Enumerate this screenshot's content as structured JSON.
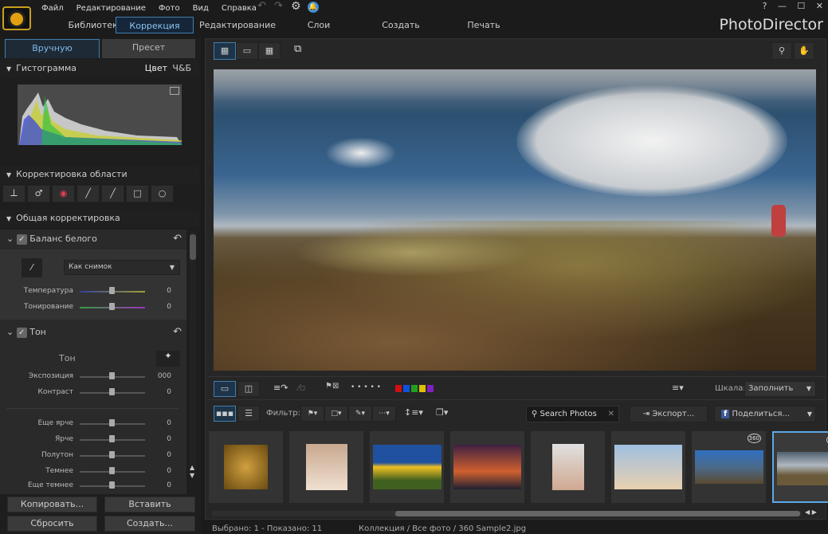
{
  "app": {
    "title": "PhotoDirector"
  },
  "menu": [
    "Файл",
    "Редактирование",
    "Фото",
    "Вид",
    "Справка"
  ],
  "modes": [
    "Библиотека",
    "Коррекция",
    "Редактирование",
    "Слои",
    "Создать",
    "Печать"
  ],
  "active_mode": "Коррекция",
  "window_controls": [
    "?",
    "—",
    "☐",
    "✕"
  ],
  "panel_tabs": [
    "Вручную",
    "Пресет"
  ],
  "histogram": {
    "title": "Гистограмма",
    "color": "Цвет",
    "bw": "Ч&Б"
  },
  "area": {
    "title": "Корректировка области",
    "tools": [
      "crop-icon",
      "spot-removal-icon",
      "red-eye-icon",
      "adjustment-brush-icon",
      "eraser-brush-icon",
      "graduated-filter-icon",
      "radial-filter-icon"
    ]
  },
  "general": {
    "title": "Общая корректировка"
  },
  "wb": {
    "title": "Баланс белого",
    "preset": "Как снимок",
    "sliders": [
      {
        "label": "Температура",
        "value": "0"
      },
      {
        "label": "Тонирование",
        "value": "0"
      }
    ]
  },
  "tone": {
    "title": "Тон",
    "subtitle": "Тон",
    "sliders": [
      {
        "label": "Экспозиция",
        "value": "000"
      },
      {
        "label": "Контраст",
        "value": "0"
      }
    ],
    "sliders2": [
      {
        "label": "Еще ярче",
        "value": "0"
      },
      {
        "label": "Ярче",
        "value": "0"
      },
      {
        "label": "Полутон",
        "value": "0"
      },
      {
        "label": "Темнее",
        "value": "0"
      },
      {
        "label": "Еще темнее",
        "value": "0"
      }
    ]
  },
  "bottom_buttons": {
    "copy": "Копировать...",
    "paste": "Вставить",
    "reset": "Сбросить",
    "create": "Создать..."
  },
  "toolbar": {
    "scale_label": "Шкала:",
    "scale_value": "Заполнить",
    "filter_label": "Фильтр:",
    "search_placeholder": "Search Photos",
    "export": "Экспорт...",
    "share": "Поделиться...",
    "color_labels": [
      "#d01010",
      "#1050e0",
      "#20a020",
      "#e0c000",
      "#8020c0"
    ],
    "dots": "• • • • •"
  },
  "thumbnails": [
    {
      "badge": ""
    },
    {
      "badge": ""
    },
    {
      "badge": ""
    },
    {
      "badge": ""
    },
    {
      "badge": ""
    },
    {
      "badge": ""
    },
    {
      "badge": "360"
    },
    {
      "badge": "360",
      "selected": true
    }
  ],
  "status": {
    "selection": "Выбрано: 1 - Показано: 11",
    "path": "Коллекция / Все фото / 360 Sample2.jpg"
  }
}
